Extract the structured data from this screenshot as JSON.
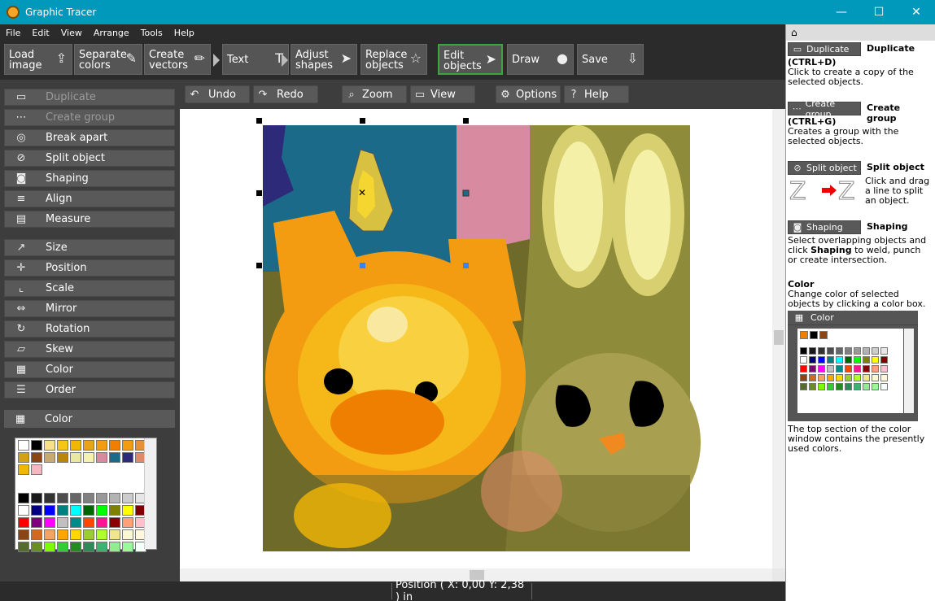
{
  "window": {
    "title": "Graphic Tracer",
    "controls": [
      "—",
      "☐",
      "✕"
    ]
  },
  "menu": [
    "File",
    "Edit",
    "View",
    "Arrange",
    "Tools",
    "Help"
  ],
  "toolbar": [
    {
      "label": "Load\nimage",
      "icon": "load-image-icon",
      "glyph": "⇪"
    },
    {
      "label": "Separate\ncolors",
      "icon": "eyedropper-icon",
      "glyph": "✎"
    },
    {
      "label": "Create\nvectors",
      "icon": "pencil-icon",
      "glyph": "✏"
    },
    {
      "label": "Text",
      "icon": "text-icon",
      "glyph": "T"
    },
    {
      "label": "Adjust\nshapes",
      "icon": "pointer-icon",
      "glyph": "➤"
    },
    {
      "label": "Replace\nobjects",
      "icon": "star-icon",
      "glyph": "☆"
    },
    {
      "label": "Edit\nobjects",
      "icon": "cursor-icon",
      "glyph": "➤",
      "active": true
    },
    {
      "label": "Draw",
      "icon": "circle-icon",
      "glyph": "●"
    },
    {
      "label": "Save",
      "icon": "save-icon",
      "glyph": "⇩"
    }
  ],
  "tools": [
    {
      "label": "Duplicate",
      "glyph": "▭",
      "disabled": true
    },
    {
      "label": "Create group",
      "glyph": "⋯",
      "disabled": true
    },
    {
      "label": "Break apart",
      "glyph": "◎"
    },
    {
      "label": "Split object",
      "glyph": "⊘"
    },
    {
      "label": "Shaping",
      "glyph": "◙"
    },
    {
      "label": "Align",
      "glyph": "≡"
    },
    {
      "label": "Measure",
      "glyph": "▤"
    },
    {
      "label": "Size",
      "glyph": "↗"
    },
    {
      "label": "Position",
      "glyph": "✛"
    },
    {
      "label": "Scale",
      "glyph": "⌞"
    },
    {
      "label": "Mirror",
      "glyph": "⇔"
    },
    {
      "label": "Rotation",
      "glyph": "↻"
    },
    {
      "label": "Skew",
      "glyph": "▱"
    },
    {
      "label": "Color",
      "glyph": "▦"
    },
    {
      "label": "Order",
      "glyph": "☰"
    }
  ],
  "color_panel": {
    "label": "Color",
    "recent": [
      "#ffffff",
      "#000000",
      "#f7e08a",
      "#f5c518",
      "#f2b705",
      "#e8a317",
      "#f39c12",
      "#ee7f00",
      "#f39c12",
      "#e69138",
      "#d4a017",
      "#8b4513",
      "#c8a96e",
      "#b8860b",
      "#e8e8a0",
      "#f4f4b0",
      "#d88aa0",
      "#1b6a8a",
      "#2d2a7a",
      "#de8a68",
      "#f2b705",
      "#f5b8c0"
    ],
    "palette": [
      [
        "#000000",
        "#1a1a1a",
        "#333333",
        "#4d4d4d",
        "#666666",
        "#808080",
        "#999999",
        "#b3b3b3",
        "#cccccc",
        "#e6e6e6"
      ],
      [
        "#ffffff",
        "#000080",
        "#0000ff",
        "#008080",
        "#00ffff",
        "#006400",
        "#00ff00",
        "#808000",
        "#ffff00",
        "#800000"
      ],
      [
        "#ff0000",
        "#800080",
        "#ff00ff",
        "#c0c0c0",
        "#008b8b",
        "#ff4500",
        "#ff1493",
        "#8b0000",
        "#ffa07a",
        "#ffc0cb"
      ],
      [
        "#8b4513",
        "#d2691e",
        "#f4a460",
        "#ffa500",
        "#ffd700",
        "#9acd32",
        "#adff2f",
        "#f0e68c",
        "#fafad2",
        "#fff8dc"
      ],
      [
        "#556b2f",
        "#6b8e23",
        "#7cfc00",
        "#32cd32",
        "#228b22",
        "#2e8b57",
        "#3cb371",
        "#90ee90",
        "#98fb98",
        "#f5fffa"
      ]
    ]
  },
  "subbar": [
    {
      "label": "Undo",
      "glyph": "↶"
    },
    {
      "label": "Redo",
      "glyph": "↷"
    },
    {
      "label": "Zoom",
      "glyph": "⌕"
    },
    {
      "label": "View",
      "glyph": "▭"
    },
    {
      "label": "Options",
      "glyph": "⚙"
    },
    {
      "label": "Help",
      "glyph": "?"
    }
  ],
  "status": {
    "position": "Position  ( X: 0,00   Y: 2,38 ) in"
  },
  "help_panel": {
    "home_glyph": "⌂",
    "sections": [
      {
        "button": "Duplicate",
        "title": "Duplicate",
        "shortcut": "(CTRL+D)",
        "text": "Click to create a copy of the selected objects."
      },
      {
        "button": "Create group",
        "title": "Create group",
        "shortcut": "(CTRL+G)",
        "text": "Creates a group with the selected objects."
      },
      {
        "button": "Split object",
        "title": "Split object",
        "text": "Click and drag a line to split an object."
      },
      {
        "button": "Shaping",
        "title": "Shaping",
        "text_pre": "Select overlapping objects and click ",
        "text_bold": "Shaping",
        "text_post": " to weld, punch or create intersection."
      }
    ],
    "color": {
      "title": "Color",
      "text": "Change color of selected objects by clicking a color box.",
      "widget_label": "Color",
      "footer": "The top section of the color window contains the presently used colors."
    }
  }
}
